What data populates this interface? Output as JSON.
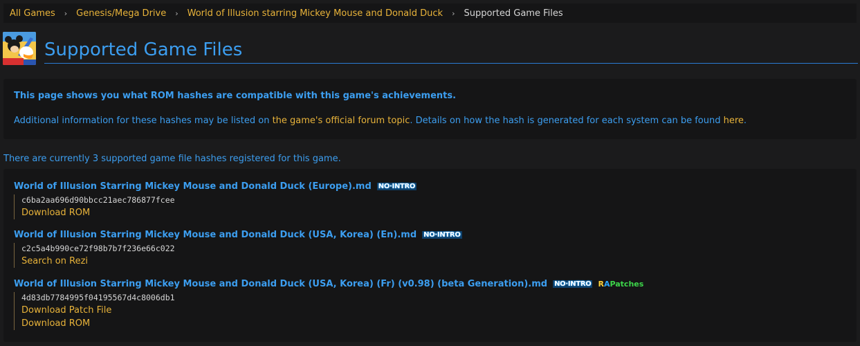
{
  "breadcrumb": {
    "items": [
      "All Games",
      "Genesis/Mega Drive",
      "World of Illusion starring Mickey Mouse and Donald Duck"
    ],
    "separator": "›",
    "current": "Supported Game Files"
  },
  "page": {
    "title": "Supported Game Files"
  },
  "info": {
    "strong_text": "This page shows you what ROM hashes are compatible with this game's achievements.",
    "line_prefix": "Additional information for these hashes may be listed on ",
    "forum_link": "the game's official forum topic",
    "line_middle": ". Details on how the hash is generated for each system can be found ",
    "here_link": "here",
    "line_suffix": "."
  },
  "count_text": "There are currently 3 supported game file hashes registered for this game.",
  "hashes": [
    {
      "name": "World of Illusion Starring Mickey Mouse and Donald Duck (Europe).md",
      "badge": "NO·INTRO",
      "hash": "c6ba2aa696d90bbcc21aec786877fcee",
      "links": [
        "Download ROM"
      ]
    },
    {
      "name": "World of Illusion Starring Mickey Mouse and Donald Duck (USA, Korea) (En).md",
      "badge": "NO·INTRO",
      "hash": "c2c5a4b990ce72f98b7b7f236e66c022",
      "links": [
        "Search on Rezi"
      ]
    },
    {
      "name": "World of Illusion Starring Mickey Mouse and Donald Duck (USA, Korea) (Fr) (v0.98) (beta Generation).md",
      "badge": "NO·INTRO",
      "badge2": {
        "r": "R",
        "a": "A",
        "rest": "Patches"
      },
      "hash": "4d83db7784995f04195567d4c8006db1",
      "links": [
        "Download Patch File",
        "Download ROM"
      ]
    }
  ],
  "colors": {
    "background": "#1b1b1c",
    "panel": "#151516",
    "accent_blue": "#3c9ef0",
    "link_gold": "#e8b33a",
    "text_light": "#d6d6d6"
  }
}
